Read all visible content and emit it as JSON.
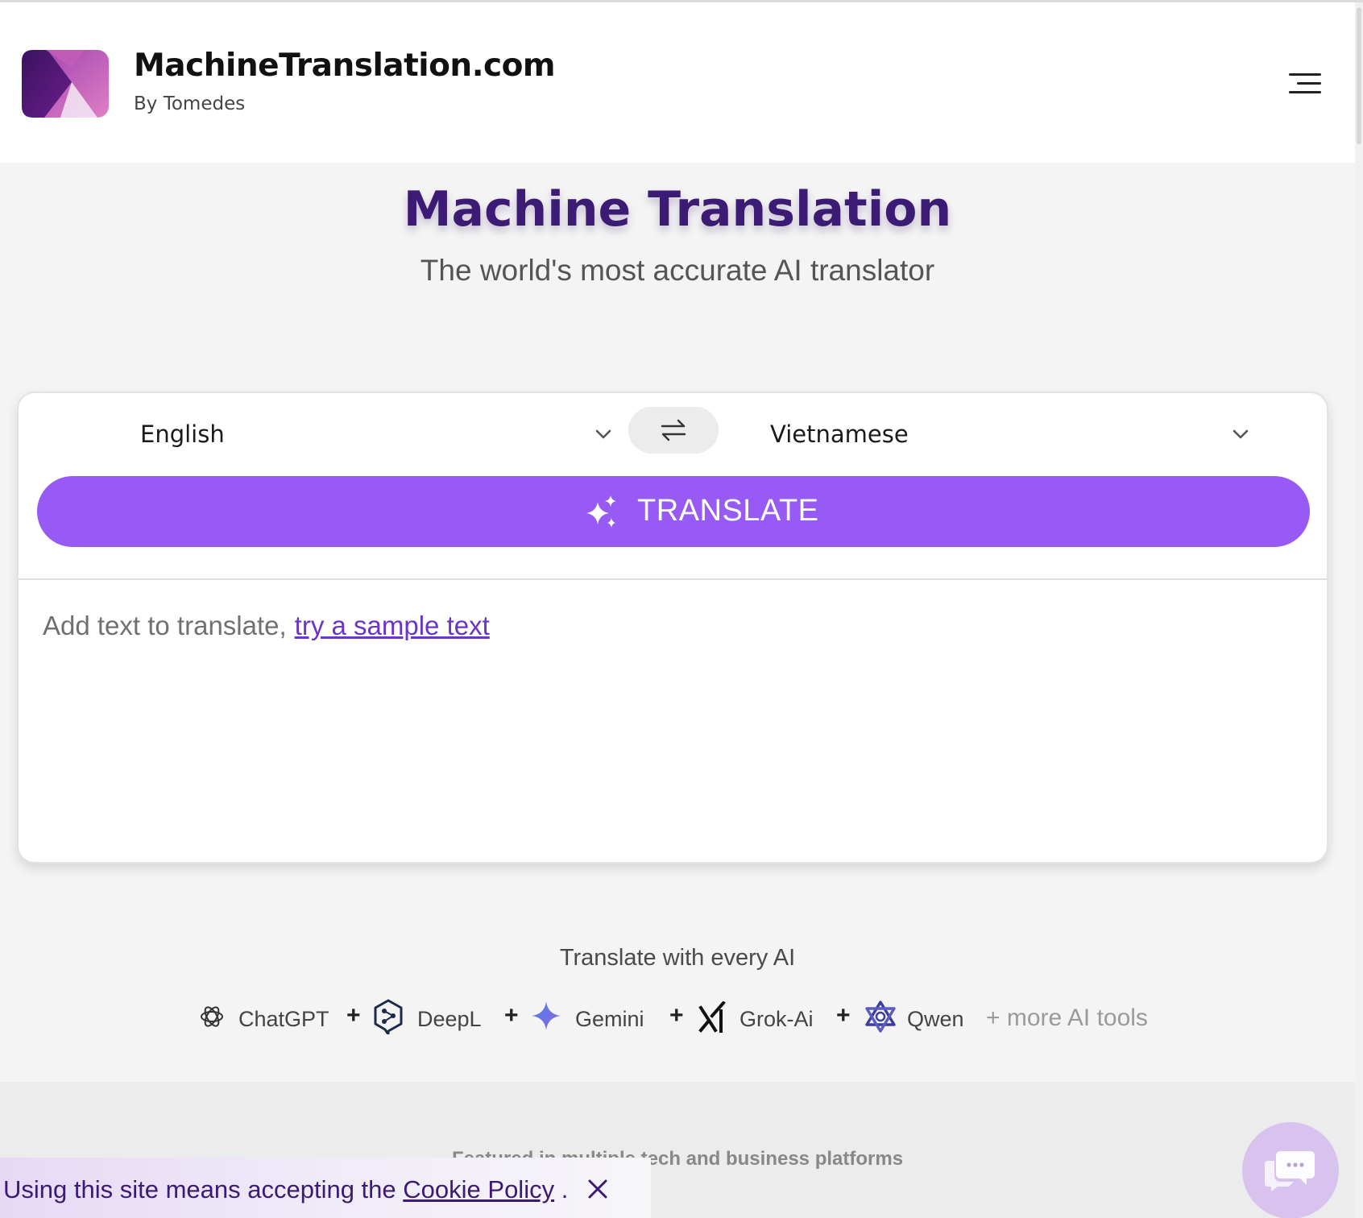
{
  "header": {
    "brand_name": "MachineTranslation.com",
    "brand_by": "By Tomedes",
    "logo_icon": "machinetranslation-logo-icon",
    "menu_icon": "hamburger-menu-icon"
  },
  "hero": {
    "title": "Machine Translation",
    "subtitle": "The world's most accurate AI translator"
  },
  "translator": {
    "source_language": "English",
    "target_language": "Vietnamese",
    "swap_icon": "swap-arrows-icon",
    "translate_label": "TRANSLATE",
    "translate_icon": "sparkles-icon",
    "placeholder": "Add text to translate,",
    "sample_link": "try a sample text"
  },
  "ai_section": {
    "heading": "Translate with every AI",
    "tools": [
      {
        "name": "ChatGPT",
        "icon": "chatgpt-icon"
      },
      {
        "name": "DeepL",
        "icon": "deepl-icon"
      },
      {
        "name": "Gemini",
        "icon": "gemini-icon"
      },
      {
        "name": "Grok-Ai",
        "icon": "grok-icon"
      },
      {
        "name": "Qwen",
        "icon": "qwen-icon"
      }
    ],
    "plus": "+",
    "more_tools": "+ more AI tools"
  },
  "featured": {
    "text": "Featured in multiple tech and business platforms"
  },
  "cookie": {
    "prefix": "Using this site means accepting the",
    "link": "Cookie Policy",
    "suffix": "."
  },
  "chat": {
    "icon": "chat-bubble-icon"
  },
  "colors": {
    "accent": "#975af4",
    "title": "#3b1b73",
    "link": "#6a35c9"
  }
}
